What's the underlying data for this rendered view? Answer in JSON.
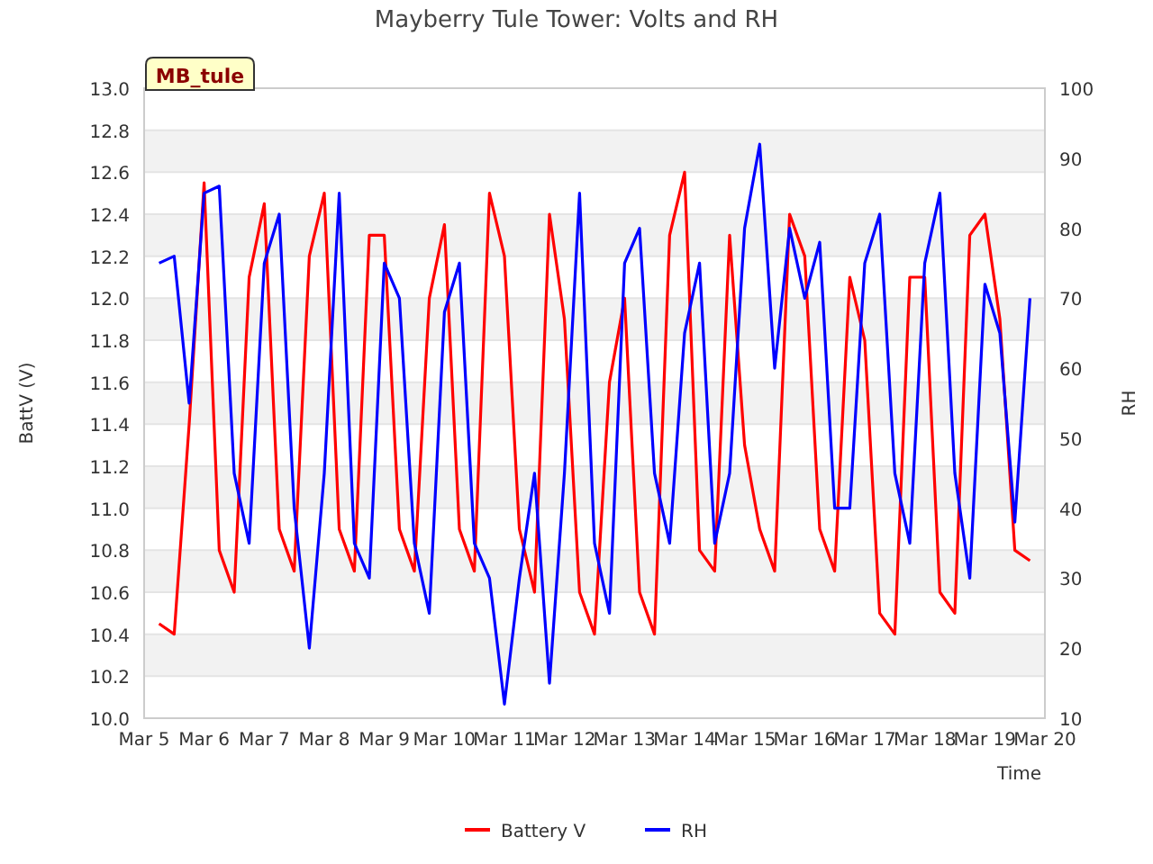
{
  "chart_data": {
    "type": "line",
    "grid": true,
    "legend": "bottom",
    "title": "Mayberry Tule Tower: Volts and RH",
    "xlabel": "Time",
    "ylabel": "BattV (V)",
    "y2label": "RH",
    "ylim": [
      10,
      13
    ],
    "y2lim": [
      10,
      100
    ],
    "categories": [
      "Mar 5",
      null,
      null,
      null,
      "Mar 6",
      null,
      null,
      null,
      "Mar 7",
      null,
      null,
      null,
      "Mar 8",
      null,
      null,
      null,
      "Mar 9",
      null,
      null,
      null,
      "Mar 10",
      null,
      null,
      null,
      "Mar 11",
      null,
      null,
      null,
      "Mar 12",
      null,
      null,
      null,
      "Mar 13",
      null,
      null,
      null,
      "Mar 14",
      null,
      null,
      null,
      "Mar 15",
      null,
      null,
      null,
      "Mar 16",
      null,
      null,
      null,
      "Mar 17",
      null,
      null,
      null,
      "Mar 18",
      null,
      null,
      null,
      "Mar 19",
      null,
      null,
      null,
      "Mar 20"
    ],
    "yticks": [
      {
        "value": 10,
        "label": "10.0"
      },
      {
        "value": 10.2,
        "label": "10.2"
      },
      {
        "value": 10.4,
        "label": "10.4"
      },
      {
        "value": 10.6,
        "label": "10.6"
      },
      {
        "value": 10.8,
        "label": "10.8"
      },
      {
        "value": 11,
        "label": "11.0"
      },
      {
        "value": 11.2,
        "label": "11.2"
      },
      {
        "value": 11.4,
        "label": "11.4"
      },
      {
        "value": 11.6,
        "label": "11.6"
      },
      {
        "value": 11.8,
        "label": "11.8"
      },
      {
        "value": 12,
        "label": "12.0"
      },
      {
        "value": 12.2,
        "label": "12.2"
      },
      {
        "value": 12.4,
        "label": "12.4"
      },
      {
        "value": 12.6,
        "label": "12.6"
      },
      {
        "value": 12.8,
        "label": "12.8"
      },
      {
        "value": 13,
        "label": "13.0"
      }
    ],
    "y2ticks": [
      10,
      20,
      30,
      40,
      50,
      60,
      70,
      80,
      90,
      100
    ],
    "series": [
      {
        "name": "Battery V",
        "color": "#ff0000",
        "values": [
          null,
          10.45,
          10.4,
          11.4,
          12.55,
          10.8,
          10.6,
          12.1,
          12.45,
          10.9,
          10.7,
          12.2,
          12.5,
          10.9,
          10.7,
          12.3,
          12.3,
          10.9,
          10.7,
          12.0,
          12.35,
          10.9,
          10.7,
          12.5,
          12.2,
          10.9,
          10.6,
          12.4,
          11.9,
          10.6,
          10.4,
          11.6,
          12.0,
          10.6,
          10.4,
          12.3,
          12.6,
          10.8,
          10.7,
          12.3,
          11.3,
          10.9,
          10.7,
          12.4,
          12.2,
          10.9,
          10.7,
          12.1,
          11.8,
          10.5,
          10.4,
          12.1,
          12.1,
          10.6,
          10.5,
          12.3,
          12.4,
          11.9,
          10.8,
          10.75,
          null
        ]
      },
      {
        "name": "RH",
        "color": "#0000ff",
        "axis": "y2",
        "values": [
          null,
          75,
          76,
          55,
          85,
          86,
          45,
          35,
          75,
          82,
          40,
          20,
          45,
          85,
          35,
          30,
          75,
          70,
          35,
          25,
          68,
          75,
          35,
          30,
          12,
          30,
          45,
          15,
          45,
          85,
          35,
          25,
          75,
          80,
          45,
          35,
          65,
          75,
          35,
          45,
          80,
          92,
          60,
          80,
          70,
          78,
          40,
          40,
          75,
          82,
          45,
          35,
          75,
          85,
          45,
          30,
          72,
          65,
          38,
          70,
          null
        ]
      }
    ],
    "annotations": [
      {
        "text": "MB_tule"
      }
    ]
  }
}
